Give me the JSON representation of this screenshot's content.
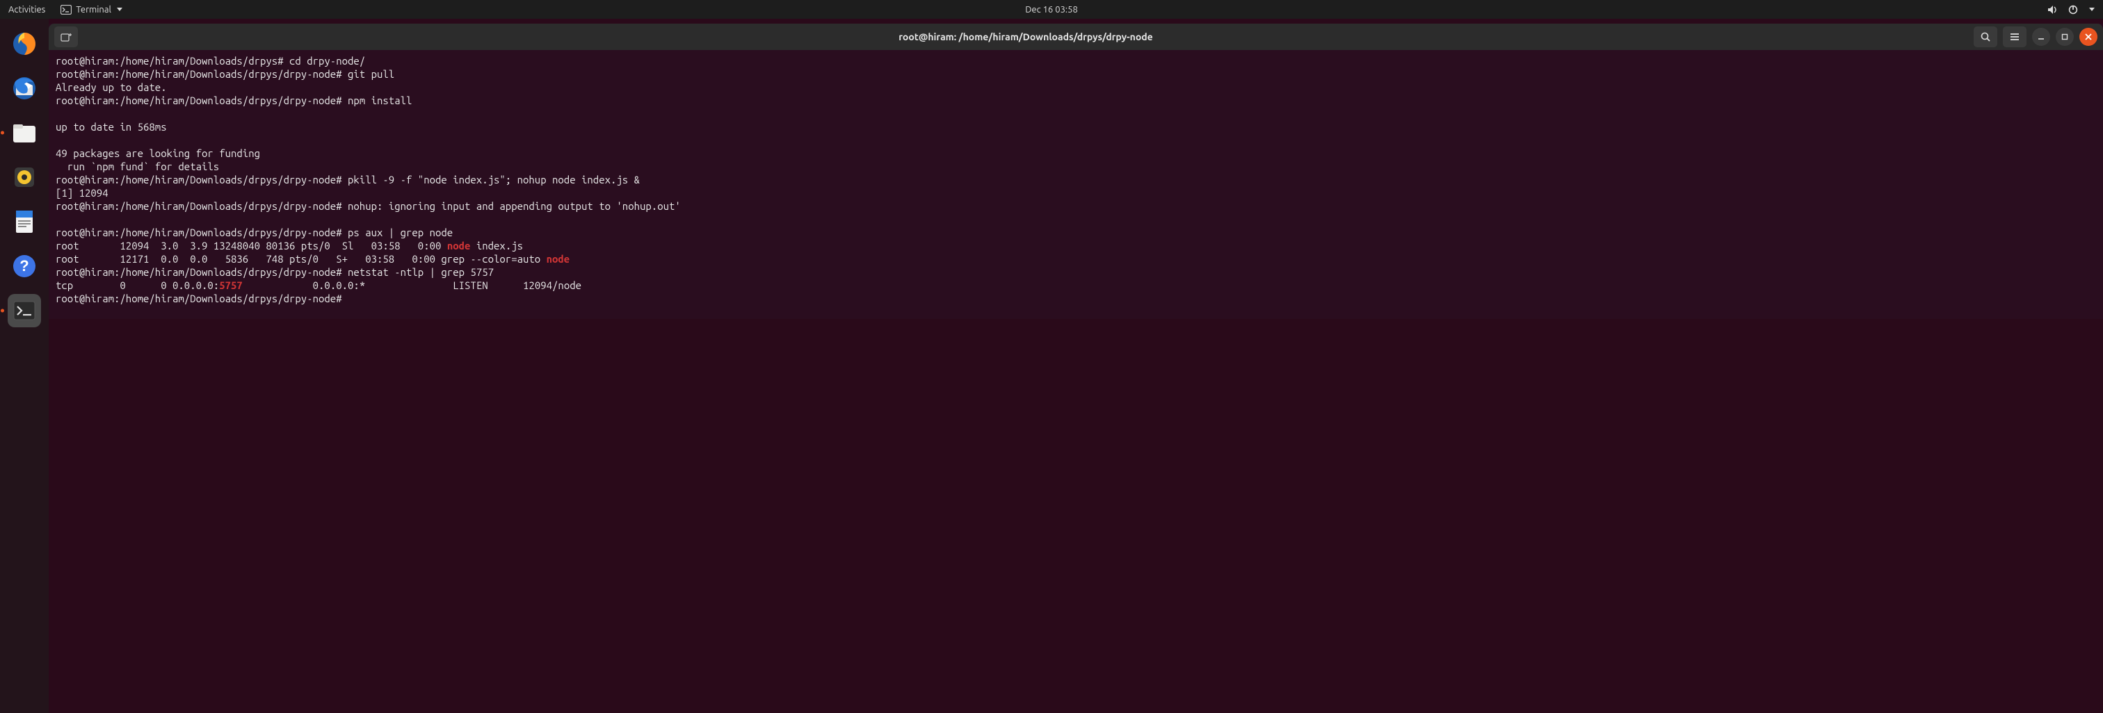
{
  "topbar": {
    "activities": "Activities",
    "app_name": "Terminal",
    "clock": "Dec 16  03:58"
  },
  "dock": {
    "items": [
      {
        "name": "firefox"
      },
      {
        "name": "thunderbird"
      },
      {
        "name": "files"
      },
      {
        "name": "rhythmbox"
      },
      {
        "name": "libreoffice-writer"
      },
      {
        "name": "help"
      },
      {
        "name": "terminal"
      }
    ]
  },
  "window": {
    "title": "root@hiram: /home/hiram/Downloads/drpys/drpy-node"
  },
  "terminal": {
    "lines": [
      {
        "segs": [
          {
            "t": "root@hiram:/home/hiram/Downloads/drpys# cd drpy-node/"
          }
        ]
      },
      {
        "segs": [
          {
            "t": "root@hiram:/home/hiram/Downloads/drpys/drpy-node# git pull"
          }
        ]
      },
      {
        "segs": [
          {
            "t": "Already up to date."
          }
        ]
      },
      {
        "segs": [
          {
            "t": "root@hiram:/home/hiram/Downloads/drpys/drpy-node# npm install"
          }
        ]
      },
      {
        "segs": [
          {
            "t": ""
          }
        ]
      },
      {
        "segs": [
          {
            "t": "up to date in 568ms"
          }
        ]
      },
      {
        "segs": [
          {
            "t": ""
          }
        ]
      },
      {
        "segs": [
          {
            "t": "49 packages are looking for funding"
          }
        ]
      },
      {
        "segs": [
          {
            "t": "  run `npm fund` for details"
          }
        ]
      },
      {
        "segs": [
          {
            "t": "root@hiram:/home/hiram/Downloads/drpys/drpy-node# pkill -9 -f \"node index.js\"; nohup node index.js &"
          }
        ]
      },
      {
        "segs": [
          {
            "t": "[1] 12094"
          }
        ]
      },
      {
        "segs": [
          {
            "t": "root@hiram:/home/hiram/Downloads/drpys/drpy-node# nohup: ignoring input and appending output to 'nohup.out'"
          }
        ]
      },
      {
        "segs": [
          {
            "t": ""
          }
        ]
      },
      {
        "segs": [
          {
            "t": "root@hiram:/home/hiram/Downloads/drpys/drpy-node# ps aux | grep node"
          }
        ]
      },
      {
        "segs": [
          {
            "t": "root       12094  3.0  3.9 13248040 80136 pts/0  Sl   03:58   0:00 "
          },
          {
            "t": "node",
            "cls": "hl-red"
          },
          {
            "t": " index.js"
          }
        ]
      },
      {
        "segs": [
          {
            "t": "root       12171  0.0  0.0   5836   748 pts/0   S+   03:58   0:00 grep --color=auto "
          },
          {
            "t": "node",
            "cls": "hl-red"
          }
        ]
      },
      {
        "segs": [
          {
            "t": "root@hiram:/home/hiram/Downloads/drpys/drpy-node# netstat -ntlp | grep 5757"
          }
        ]
      },
      {
        "segs": [
          {
            "t": "tcp        0      0 0.0.0.0:"
          },
          {
            "t": "5757",
            "cls": "hl-red"
          },
          {
            "t": "            0.0.0.0:*               LISTEN      12094/node"
          }
        ]
      },
      {
        "segs": [
          {
            "t": "root@hiram:/home/hiram/Downloads/drpys/drpy-node# "
          }
        ]
      }
    ]
  }
}
